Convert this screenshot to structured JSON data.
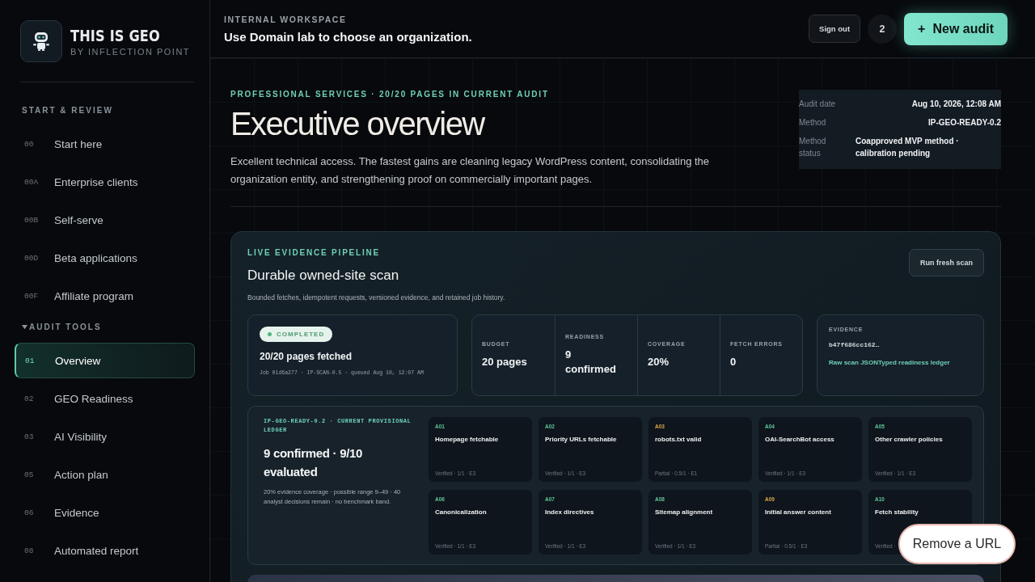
{
  "brand": {
    "title": "THIS IS GEO",
    "subtitle": "BY INFLECTION POINT"
  },
  "sidebar": {
    "sections": [
      {
        "title": "START & REVIEW",
        "items": [
          {
            "code": "00",
            "label": "Start here",
            "selected": false
          },
          {
            "code": "00A",
            "label": "Enterprise clients",
            "selected": false
          },
          {
            "code": "00B",
            "label": "Self-serve",
            "selected": false
          },
          {
            "code": "00D",
            "label": "Beta applications",
            "selected": false
          },
          {
            "code": "00F",
            "label": "Affiliate program",
            "selected": false
          }
        ]
      },
      {
        "title": "AUDIT TOOLS",
        "expanded": true,
        "items": [
          {
            "code": "01",
            "label": "Overview",
            "selected": true
          },
          {
            "code": "02",
            "label": "GEO Readiness",
            "selected": false
          },
          {
            "code": "03",
            "label": "AI Visibility",
            "selected": false
          },
          {
            "code": "05",
            "label": "Action plan",
            "selected": false
          },
          {
            "code": "06",
            "label": "Evidence",
            "selected": false
          },
          {
            "code": "08",
            "label": "Automated report",
            "selected": false
          }
        ]
      }
    ]
  },
  "topbar": {
    "eyebrow": "INTERNAL WORKSPACE",
    "message": "Use Domain lab to choose an organization.",
    "sign_out": "Sign out",
    "count": "2",
    "new_audit": {
      "icon": "+",
      "label": "New audit"
    }
  },
  "header": {
    "eyebrow": "PROFESSIONAL SERVICES · 20/20 PAGES IN CURRENT AUDIT",
    "title": "Executive overview",
    "summary": "Excellent technical access. The fastest gains are cleaning legacy WordPress content, consolidating the organization entity, and strengthening proof on commercially important pages.",
    "meta": [
      {
        "label": "Audit date",
        "value": "Aug 10, 2026, 12:08 AM"
      },
      {
        "label": "Method",
        "value": "IP-GEO-READY-0.2"
      },
      {
        "label": "Method status",
        "value": "Coapproved MVP method · calibration pending"
      }
    ]
  },
  "pipeline": {
    "eyebrow": "LIVE EVIDENCE PIPELINE",
    "title": "Durable owned-site scan",
    "description": "Bounded fetches, idempotent requests, versioned evidence, and retained job history.",
    "run_button": "Run fresh scan",
    "job": {
      "status": "COMPLETED",
      "headline": "20/20 pages fetched",
      "detail": "Job 01d6a277 · IP-SCAN-0.5 · queued Aug 10, 12:07 AM"
    },
    "stats": [
      {
        "label": "BUDGET",
        "value": "20 pages"
      },
      {
        "label": "READINESS",
        "value": "9 confirmed"
      },
      {
        "label": "COVERAGE",
        "value": "20%"
      },
      {
        "label": "FETCH ERRORS",
        "value": "0"
      }
    ],
    "evidence": {
      "label": "EVIDENCE",
      "hash": "b47f686cc162…",
      "links": [
        "Raw scan JSON",
        "Typed readiness ledger"
      ]
    }
  },
  "ledger": {
    "eyebrow": "IP-GEO-READY-0.2 · CURRENT PROVISIONAL LEDGER",
    "headline": "9 confirmed · 9/10 evaluated",
    "note": "20% evidence coverage · possible range 9–49 · 40 analyst decisions remain · no benchmark band.",
    "checks": [
      {
        "code": "A01",
        "title": "Homepage fetchable",
        "color": "#5fc49a",
        "result": "Verified · 1/1 · E3"
      },
      {
        "code": "A02",
        "title": "Priority URLs fetchable",
        "color": "#5fc49a",
        "result": "Verified · 1/1 · E3"
      },
      {
        "code": "A03",
        "title": "robots.txt valid",
        "color": "#d9a44a",
        "result": "Partial · 0.5/1 · E1"
      },
      {
        "code": "A04",
        "title": "OAI-SearchBot access",
        "color": "#5fc49a",
        "result": "Verified · 1/1 · E3"
      },
      {
        "code": "A05",
        "title": "Other crawler policies",
        "color": "#5fc49a",
        "result": "Verified · 1/1 · E3"
      },
      {
        "code": "A06",
        "title": "Canonicalization",
        "color": "#5fc49a",
        "result": "Verified · 1/1 · E3"
      },
      {
        "code": "A07",
        "title": "Index directives",
        "color": "#5fc49a",
        "result": "Verified · 1/1 · E3"
      },
      {
        "code": "A08",
        "title": "Sitemap alignment",
        "color": "#5fc49a",
        "result": "Verified · 1/1 · E3"
      },
      {
        "code": "A09",
        "title": "Initial answer content",
        "color": "#d9a44a",
        "result": "Partial · 0.5/1 · E3"
      },
      {
        "code": "A10",
        "title": "Fetch stability",
        "color": "#5fc49a",
        "result": "Verified ·"
      }
    ]
  },
  "toast": "Remove a URL"
}
